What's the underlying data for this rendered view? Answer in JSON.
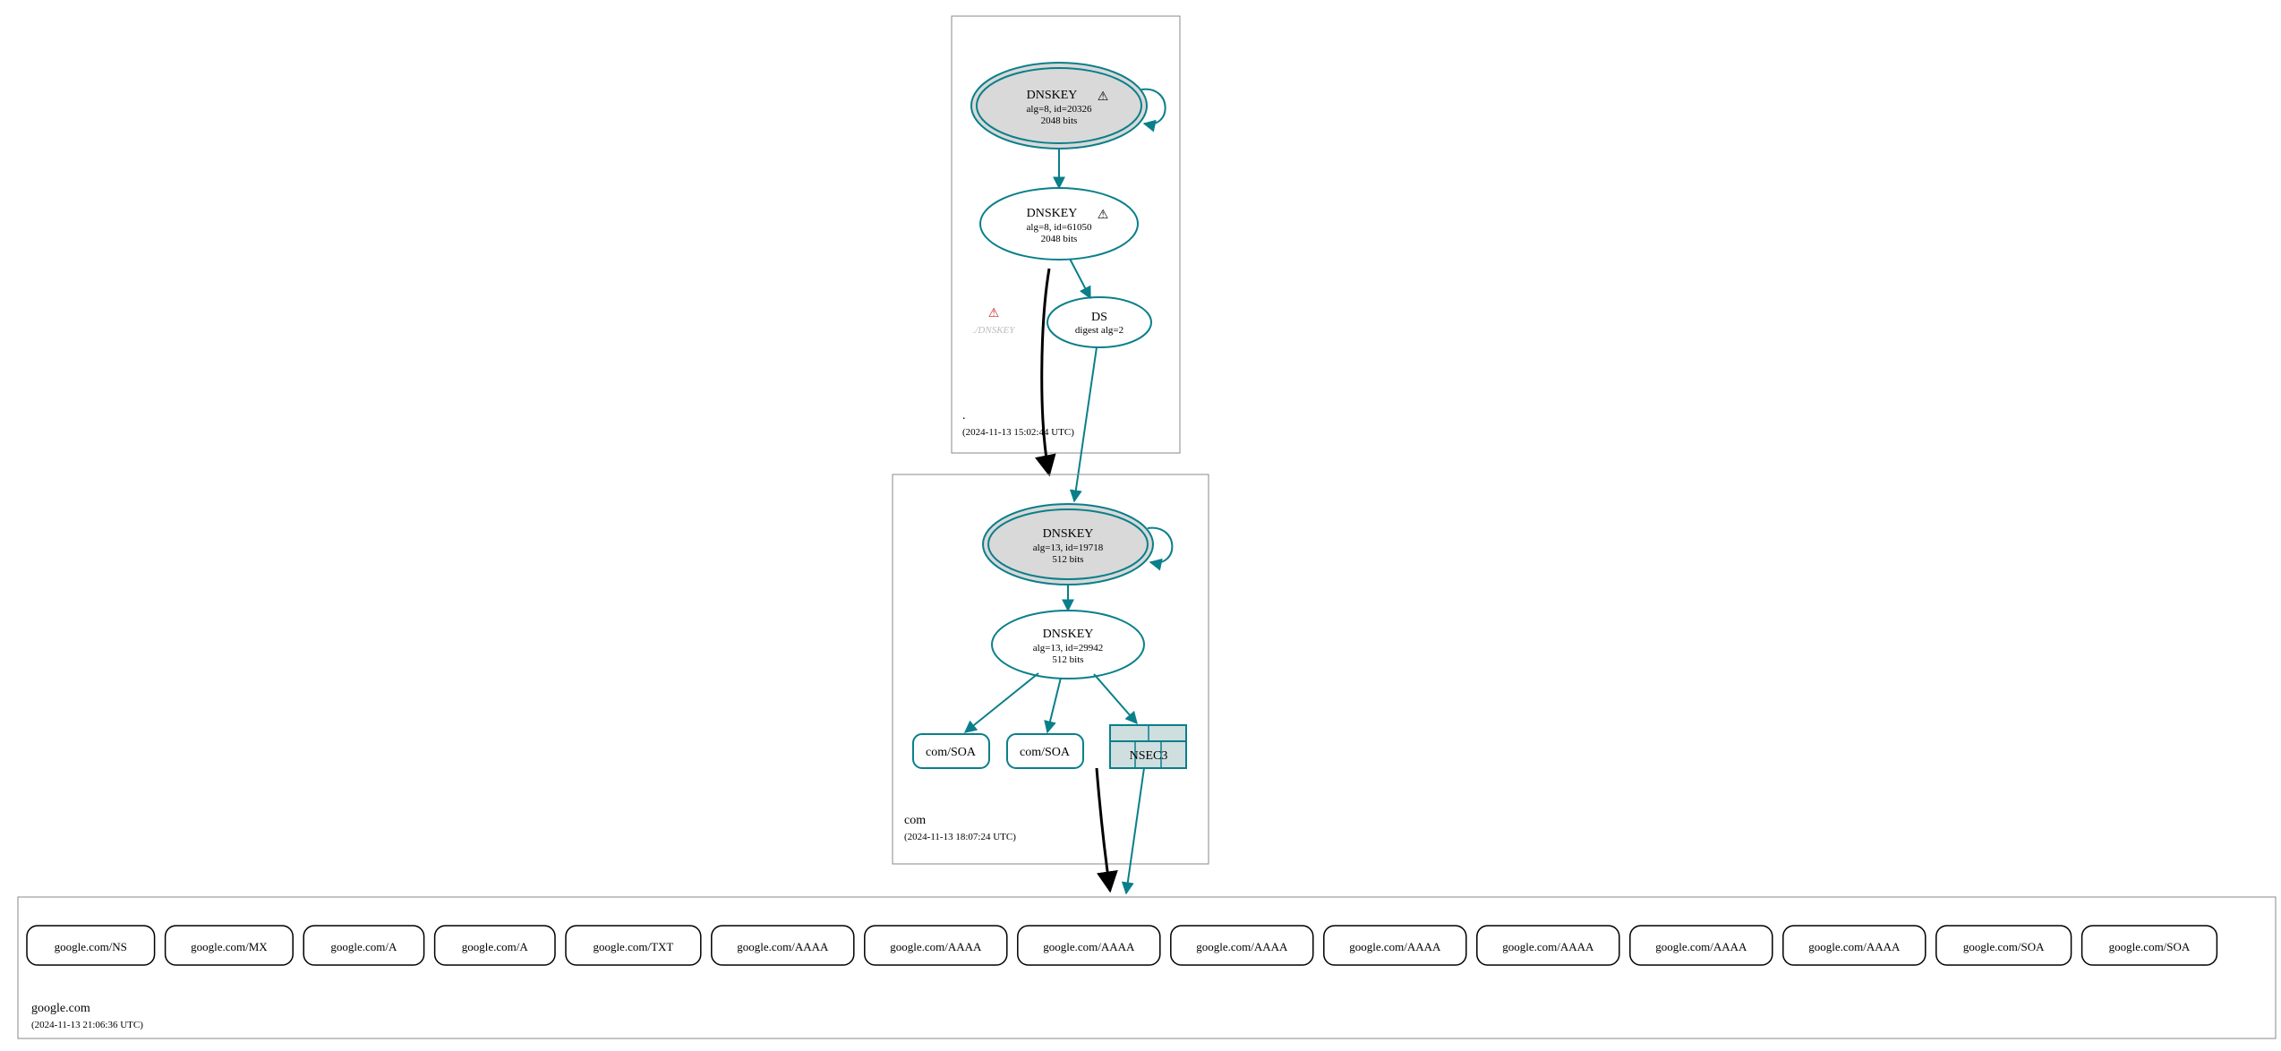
{
  "zones": {
    "root": {
      "name": ".",
      "timestamp": "(2024-11-13 15:02:44 UTC)"
    },
    "com": {
      "name": "com",
      "timestamp": "(2024-11-13 18:07:24 UTC)"
    },
    "google": {
      "name": "google.com",
      "timestamp": "(2024-11-13 21:06:36 UTC)"
    }
  },
  "nodes": {
    "root_ksk": {
      "title": "DNSKEY",
      "warn": "⚠",
      "line2": "alg=8, id=20326",
      "line3": "2048 bits"
    },
    "root_zsk": {
      "title": "DNSKEY",
      "warn": "⚠",
      "line2": "alg=8, id=61050",
      "line3": "2048 bits"
    },
    "root_ds": {
      "title": "DS",
      "line2": "digest alg=2"
    },
    "root_missing": {
      "label": "./DNSKEY",
      "warn": "⚠"
    },
    "com_ksk": {
      "title": "DNSKEY",
      "line2": "alg=13, id=19718",
      "line3": "512 bits"
    },
    "com_zsk": {
      "title": "DNSKEY",
      "line2": "alg=13, id=29942",
      "line3": "512 bits"
    },
    "com_soa1": {
      "label": "com/SOA"
    },
    "com_soa2": {
      "label": "com/SOA"
    },
    "nsec3": {
      "label": "NSEC3"
    }
  },
  "leaves": [
    "google.com/NS",
    "google.com/MX",
    "google.com/A",
    "google.com/A",
    "google.com/TXT",
    "google.com/AAAA",
    "google.com/AAAA",
    "google.com/AAAA",
    "google.com/AAAA",
    "google.com/AAAA",
    "google.com/AAAA",
    "google.com/AAAA",
    "google.com/AAAA",
    "google.com/SOA",
    "google.com/SOA"
  ],
  "colors": {
    "teal": "#0a7f8a"
  }
}
